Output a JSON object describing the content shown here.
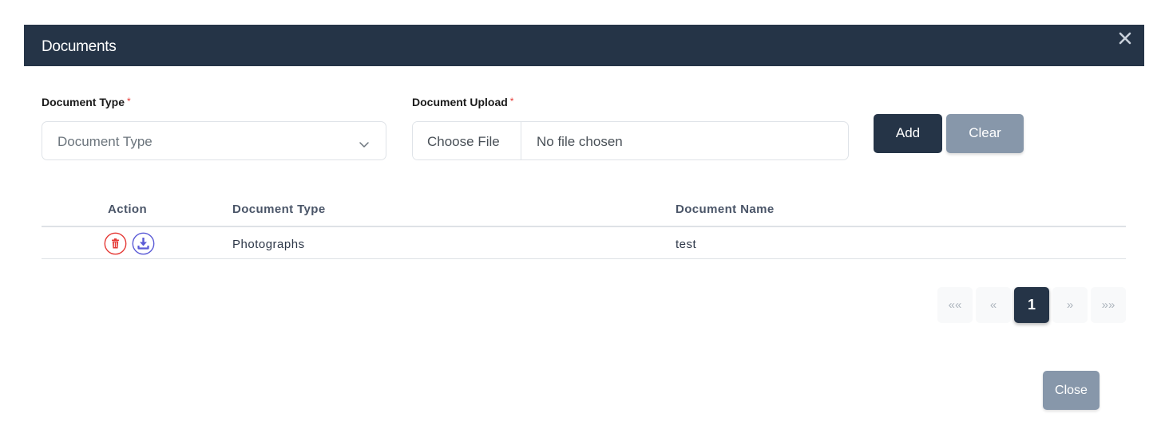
{
  "modal": {
    "title": "Documents"
  },
  "form": {
    "document_type": {
      "label": "Document Type",
      "required_mark": "*",
      "selected": "Document Type"
    },
    "document_upload": {
      "label": "Document Upload",
      "required_mark": "*",
      "button_label": "Choose File",
      "status": "No file chosen"
    },
    "add_label": "Add",
    "clear_label": "Clear"
  },
  "table": {
    "columns": [
      "Action",
      "Document Type",
      "Document Name"
    ],
    "rows": [
      {
        "actions": [
          "trash-icon",
          "download-icon"
        ],
        "document_type": "Photographs",
        "document_name": "test"
      }
    ]
  },
  "pagination": {
    "first": "««",
    "prev": "«",
    "current": "1",
    "next": "»",
    "last": "»»"
  },
  "footer": {
    "close_label": "Close"
  },
  "colors": {
    "header_bg": "#253447",
    "primary": "#253447",
    "secondary": "#8797aa",
    "required": "#e53935",
    "delete": "#e53935",
    "download": "#5b5bd6"
  }
}
